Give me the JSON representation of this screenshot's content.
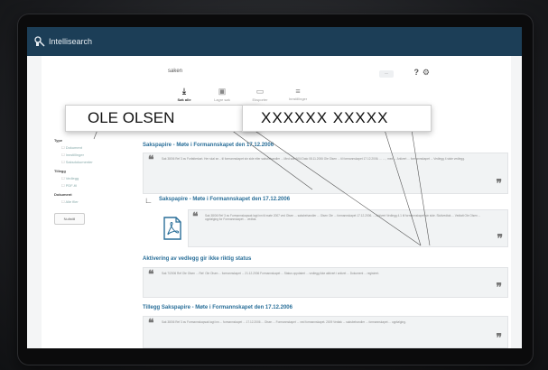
{
  "app": {
    "name": "Intellisearch",
    "bar_color": "#1c3e57"
  },
  "search": {
    "query": "saken",
    "result_count": "··",
    "help": "?",
    "settings": "⚙"
  },
  "toolbar": [
    {
      "label": "Søk alle",
      "icon": "download-icon",
      "active": true
    },
    {
      "label": "Lagre søk",
      "icon": "save-icon",
      "active": false
    },
    {
      "label": "Eksporter",
      "icon": "folder-icon",
      "active": false
    },
    {
      "label": "Innstillinger",
      "icon": "list-icon",
      "active": false
    }
  ],
  "overlay": {
    "person_name": "OLE OLSEN",
    "masked_name": "XXXXXX XXXXX"
  },
  "sidebar": {
    "groups": [
      {
        "label": "Type",
        "items": [
          "Dokument",
          "Innstillinger",
          "Saksdokumenter"
        ]
      },
      {
        "label": "Tillegg",
        "items": [
          "Vedlegg",
          "PDF-fil"
        ]
      },
      {
        "label": "Dokument",
        "items": [
          "Alle filer"
        ]
      }
    ],
    "reset_label": "Nullstill"
  },
  "results": [
    {
      "title": "Sakspapire - Møte i Formannskapet den 17.12.2006",
      "snippet": "Sak 38/06 Ref 3 av Forfatterkart. Her skal se... til formannskapet sin side eller saksbehandler ... Med sak 6/04 Dato 08.11.2006 Ole Olsen ... til formannskapet 17.12.2006. ... ... , med ... Arkivert ... formannskapet ... Vedlegg 4 siste vedlegg."
    },
    {
      "title": "Sakspapire - Møte i Formannskapet den 17.12.2006",
      "snippet": "Sak 38/06 Ref 3 av Formannskapsak lagt inn til møte 2007 ved Olsen ... saksbehandler ... Olsen Ole ... formannskapet 17.12.2006. ... Arkivert Vedlegg 4.1 til formannskapet sin side. Sluttvedtak ... Vedtatt Ole Olsen ... oppfølging for Formannskapet ... vedtak."
    },
    {
      "title": "Aktivering av vedlegg gir ikke riktig status",
      "snippet": "Sak 7/2006 Ref Ole Olsen ... Ref: Ole Olsen ... formannskapet ... 21.12.2006 Formannskapet ... Status oppdatert ... vedlegg ikke aktivert i arkivet ... Dokument ... registrert."
    },
    {
      "title": "Tillegg Sakspapire - Møte i Formannskapet den 17.12.2006",
      "snippet": "Sak 38/06 Ref 3 av Formannskapsak lagt inn ... formannskapet ... 17.12.2006 ... Olsen ... Formannskapet ... ved formannskapet. 2009 Vedtak ... saksbehandler ... formannskapet ... oppfølging."
    }
  ]
}
